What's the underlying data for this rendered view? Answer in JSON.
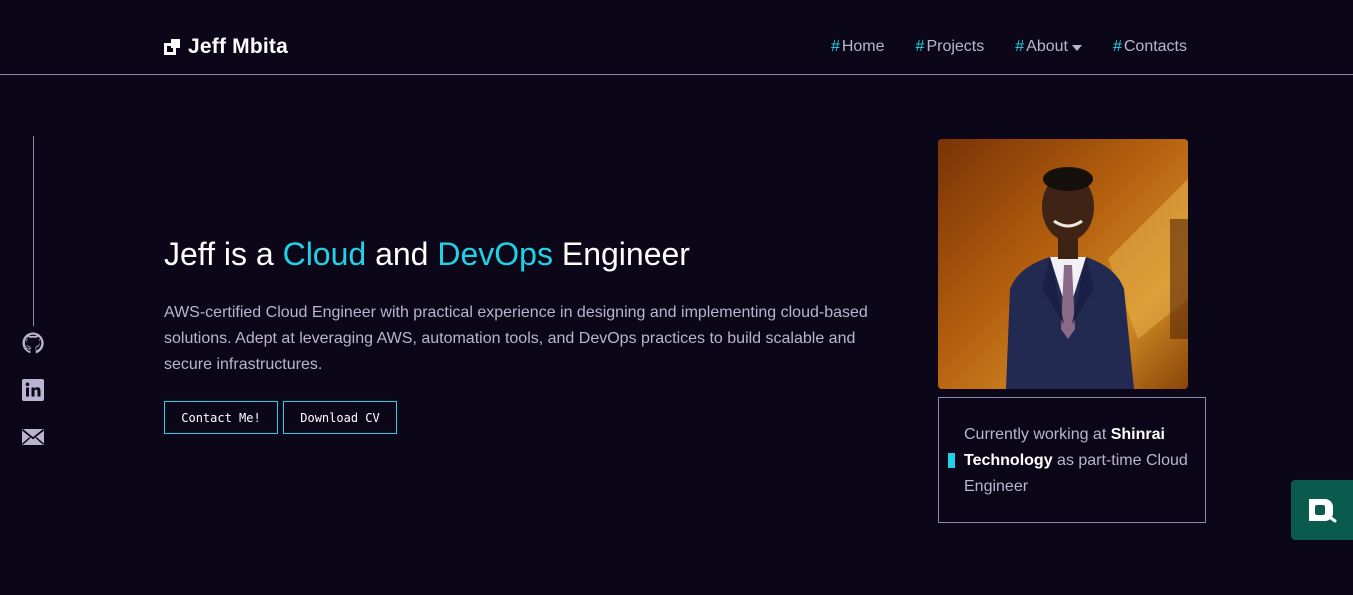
{
  "brand": {
    "name": "Jeff Mbita"
  },
  "nav": {
    "items": [
      {
        "hash": "#",
        "label": "Home"
      },
      {
        "hash": "#",
        "label": "Projects"
      },
      {
        "hash": "#",
        "label": "About"
      },
      {
        "hash": "#",
        "label": "Contacts"
      }
    ]
  },
  "hero": {
    "title_prefix": "Jeff is a ",
    "title_accent1": "Cloud",
    "title_mid": " and ",
    "title_accent2": "DevOps",
    "title_suffix": " Engineer",
    "description": "AWS-certified Cloud Engineer with practical experience in designing and implementing cloud-based solutions. Adept at leveraging AWS, automation tools, and DevOps practices to build scalable and secure infrastructures.",
    "contact_button": "Contact Me!",
    "cv_button": "Download CV"
  },
  "status": {
    "prefix": "Currently working at ",
    "company": "Shinrai Technology",
    "suffix": " as part-time Cloud Engineer"
  },
  "social": [
    "github-icon",
    "linkedin-icon",
    "mail-icon"
  ],
  "colors": {
    "background": "#0b0718",
    "accent": "#20d2e6",
    "muted_text": "#b9b5d0",
    "border": "#8b87a6",
    "chat_widget": "#0b5a4e"
  }
}
